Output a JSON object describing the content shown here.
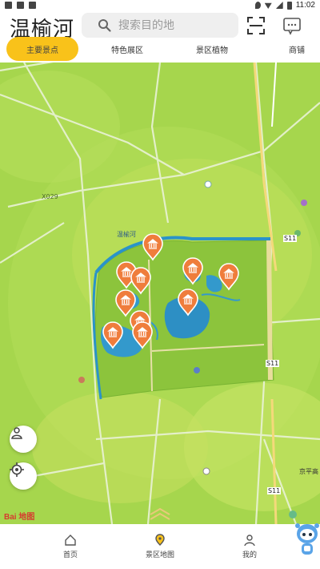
{
  "status": {
    "time": "11:02"
  },
  "header": {
    "title": "温榆河"
  },
  "search": {
    "placeholder": "搜索目的地"
  },
  "tabs": [
    {
      "label": "主要景点",
      "active": true
    },
    {
      "label": "特色展区",
      "active": false
    },
    {
      "label": "景区植物",
      "active": false
    },
    {
      "label": "商铺",
      "active": false
    }
  ],
  "map": {
    "labels": {
      "road_s11_a": "S11",
      "road_s11_b": "S11",
      "road_s11_c": "S11",
      "road_x029": "X029",
      "jingping": "京平高",
      "park_name": "温榆河"
    },
    "baidu": "Bai 地图"
  },
  "nav": [
    {
      "label": "首页"
    },
    {
      "label": "景区地图"
    },
    {
      "label": "我的"
    }
  ],
  "colors": {
    "accent": "#f9c21a",
    "marker": "#ef7d3c",
    "river": "#2a93c9",
    "map_green": "#a9d84f"
  }
}
